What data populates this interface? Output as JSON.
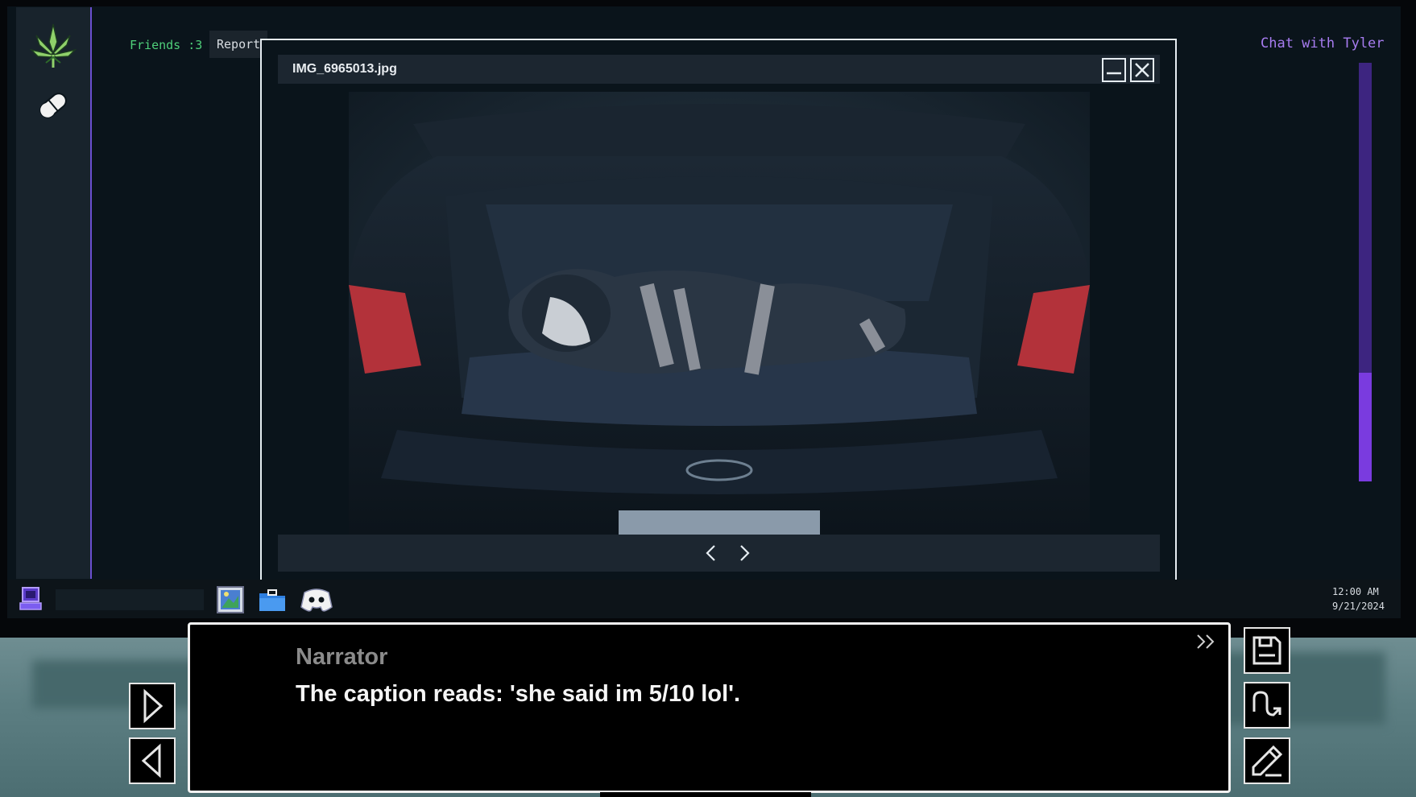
{
  "monitor": {
    "friends_label": "Friends :3",
    "reports_tab": "Reports",
    "chat_title": "Chat with Tyler",
    "chat_scroll_position": 0.74
  },
  "viewer": {
    "title": "IMG_6965013.jpg",
    "minimize_icon": "minimize-icon",
    "close_icon": "close-icon",
    "prev_icon": "chevron-left-icon",
    "next_icon": "chevron-right-icon"
  },
  "taskbar": {
    "clock_time": "12:00 AM",
    "clock_date": "9/21/2024",
    "apps": [
      "image-viewer-icon",
      "folder-icon",
      "discord-icon"
    ]
  },
  "dialogue": {
    "speaker": "Narrator",
    "text": "The caption reads: 'she said im 5/10 lol'.",
    "skip_icon": "fast-forward-icon"
  },
  "controls": {
    "left": [
      "forward-icon",
      "back-icon"
    ],
    "right": [
      "save-icon",
      "load-icon",
      "edit-icon"
    ]
  },
  "colors": {
    "accent_purple": "#a77cf0",
    "friends_green": "#4fcf7a",
    "scroll_track": "#3d2580",
    "scroll_thumb": "#7a3bdf"
  }
}
